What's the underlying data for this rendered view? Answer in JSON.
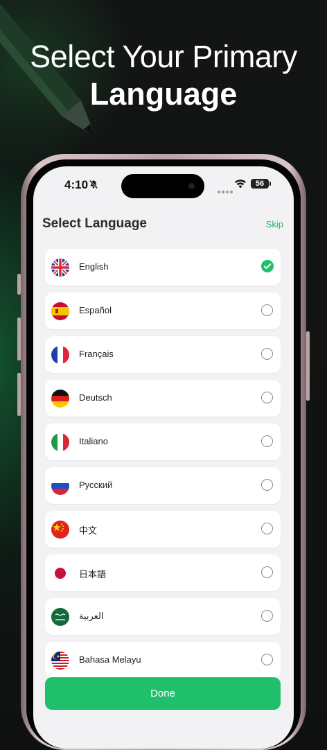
{
  "headline": {
    "line1": "Select Your Primary",
    "line2": "Language"
  },
  "status_bar": {
    "time": "4:10",
    "battery": "56"
  },
  "screen": {
    "title": "Select Language",
    "skip_label": "Skip",
    "languages": [
      {
        "label": "English",
        "flag": "uk-flag-icon",
        "selected": true
      },
      {
        "label": "Español",
        "flag": "spain-flag-icon",
        "selected": false
      },
      {
        "label": "Français",
        "flag": "france-flag-icon",
        "selected": false
      },
      {
        "label": "Deutsch",
        "flag": "germany-flag-icon",
        "selected": false
      },
      {
        "label": "Italiano",
        "flag": "italy-flag-icon",
        "selected": false
      },
      {
        "label": "Русский",
        "flag": "russia-flag-icon",
        "selected": false
      },
      {
        "label": "中文",
        "flag": "china-flag-icon",
        "selected": false
      },
      {
        "label": "日本語",
        "flag": "japan-flag-icon",
        "selected": false
      },
      {
        "label": "العربية",
        "flag": "saudi-flag-icon",
        "selected": false
      },
      {
        "label": "Bahasa Melayu",
        "flag": "malaysia-flag-icon",
        "selected": false
      }
    ],
    "done_label": "Done"
  },
  "colors": {
    "accent": "#1fbf6c",
    "background": "#101211",
    "screen_bg": "#f2f2f4"
  }
}
